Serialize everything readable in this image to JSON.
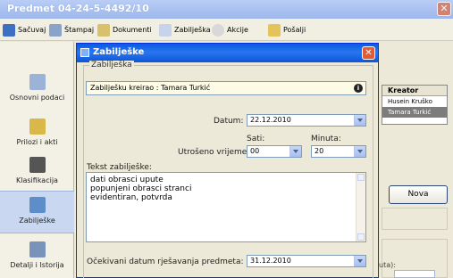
{
  "window": {
    "title": "Predmet  04-24-5-4492/10",
    "close_icon": "close-icon"
  },
  "toolbar": {
    "save": "Sačuvaj",
    "print": "Štampaj",
    "documents": "Dokumenti",
    "notes": "Zabilješka",
    "actions": "Akcije",
    "send": "Pošalji"
  },
  "sidebar": {
    "items": [
      {
        "label": "Osnovni podaci",
        "icon": "basic-data-icon"
      },
      {
        "label": "Prilozi i akti",
        "icon": "attachments-icon"
      },
      {
        "label": "Klasifikacija",
        "icon": "classification-icon"
      },
      {
        "label": "Zabilješke",
        "icon": "notes-icon",
        "active": true
      },
      {
        "label": "Detalji i Istorija",
        "icon": "history-icon"
      }
    ]
  },
  "background_panel": {
    "creator_header": "Kreator",
    "creators": [
      "Husein Kruško",
      "Tamara Turkić"
    ],
    "new_button": "Nova",
    "partial_label": "uta):"
  },
  "dialog": {
    "title": "Zabilješke",
    "group_label": "Zabilješka",
    "created_by": "Zabilješku kreirao : Tamara Turkić",
    "date_label": "Datum:",
    "date_value": "22.12.2010",
    "hours_label": "Sati:",
    "minutes_label": "Minuta:",
    "time_spent_label": "Utrošeno vrijeme:",
    "hours_value": "00",
    "minutes_value": "20",
    "text_label": "Tekst zabilješke:",
    "text_lines": [
      "dati obrasci upute",
      "popunjeni obrasci stranci",
      "evidentiran, potvrda"
    ],
    "expected_date_label": "Očekivani datum rješavanja predmeta:",
    "expected_date_value": "31.12.2010"
  },
  "colors": {
    "dialog_title": "#0a5ae0",
    "active_sidebar": "#c9d7f0",
    "selected_row": "#7c7c7c"
  }
}
